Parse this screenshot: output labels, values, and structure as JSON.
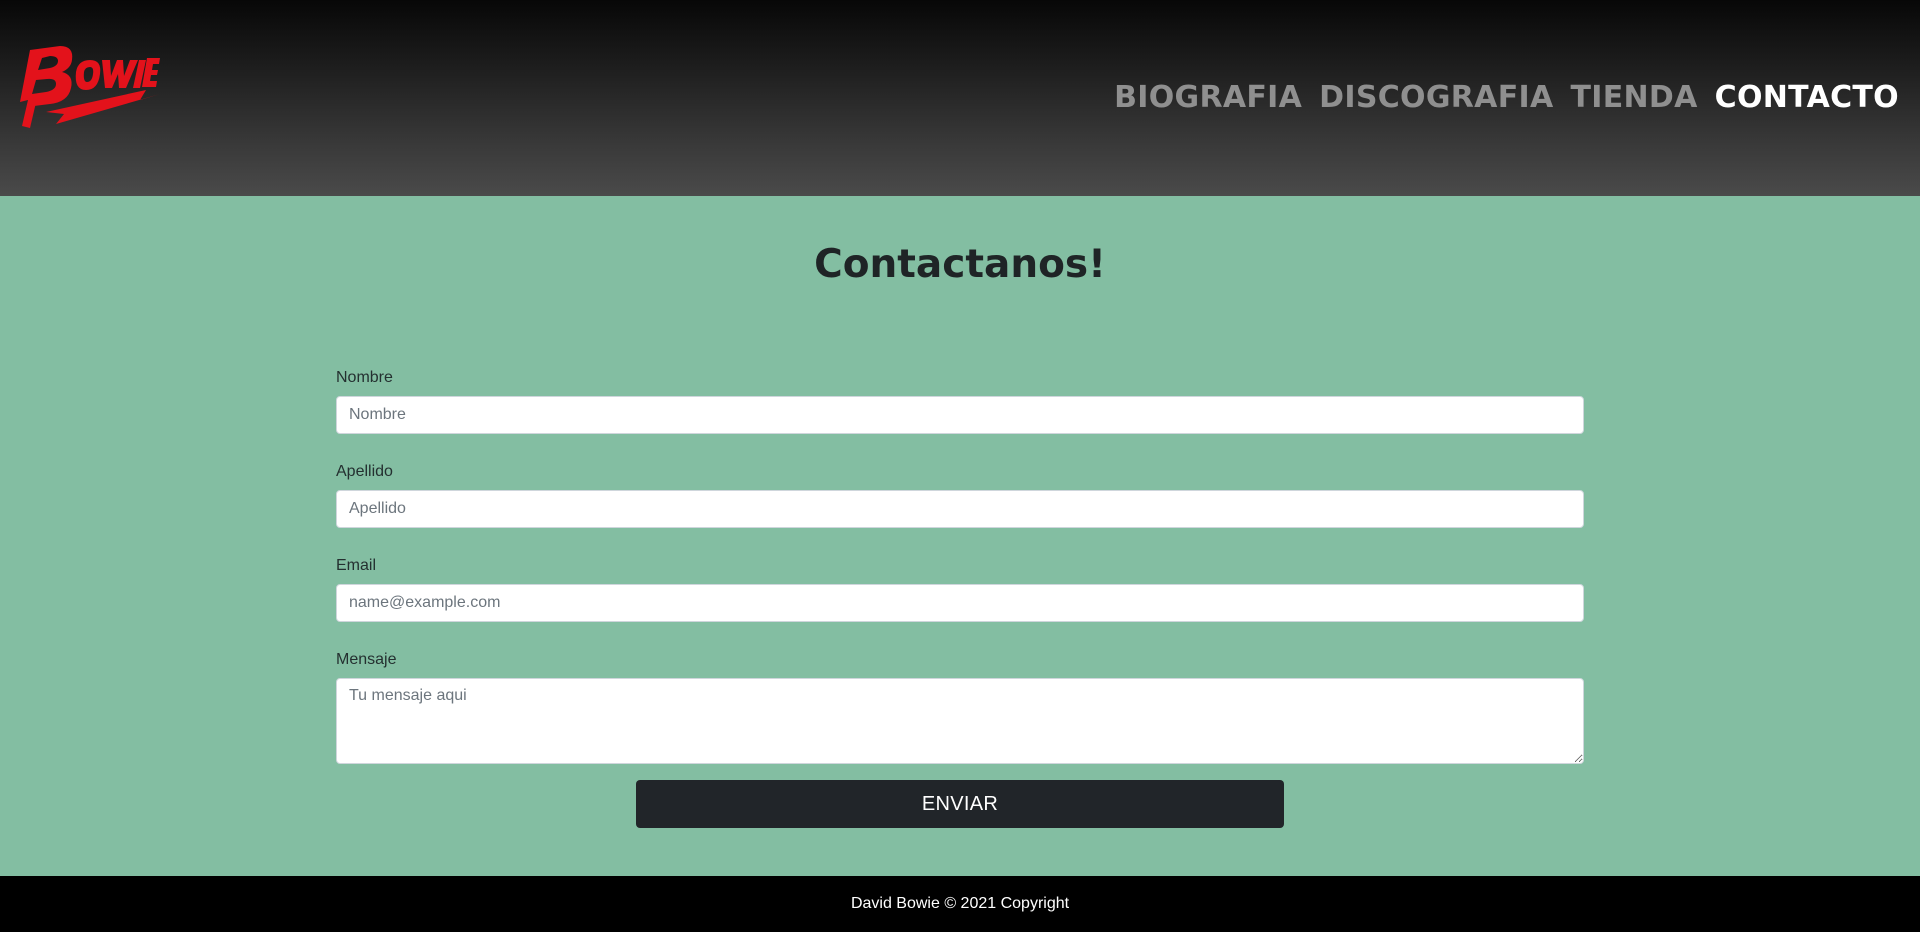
{
  "header": {
    "logo": {
      "text": "BOWIE",
      "icon": "bowie-lightning-logo",
      "color": "#e3121b"
    },
    "nav": [
      {
        "label": "BIOGRAFIA",
        "active": false
      },
      {
        "label": "DISCOGRAFIA",
        "active": false
      },
      {
        "label": "TIENDA",
        "active": false
      },
      {
        "label": "CONTACTO",
        "active": true
      }
    ]
  },
  "main": {
    "title": "Contactanos!",
    "background_color": "#83bea2",
    "form": {
      "nombre": {
        "label": "Nombre",
        "placeholder": "Nombre",
        "value": ""
      },
      "apellido": {
        "label": "Apellido",
        "placeholder": "Apellido",
        "value": ""
      },
      "email": {
        "label": "Email",
        "placeholder": "name@example.com",
        "value": ""
      },
      "mensaje": {
        "label": "Mensaje",
        "placeholder": "Tu mensaje aqui",
        "value": ""
      },
      "submit_label": "ENVIAR"
    }
  },
  "footer": {
    "text": "David Bowie © 2021 Copyright"
  }
}
